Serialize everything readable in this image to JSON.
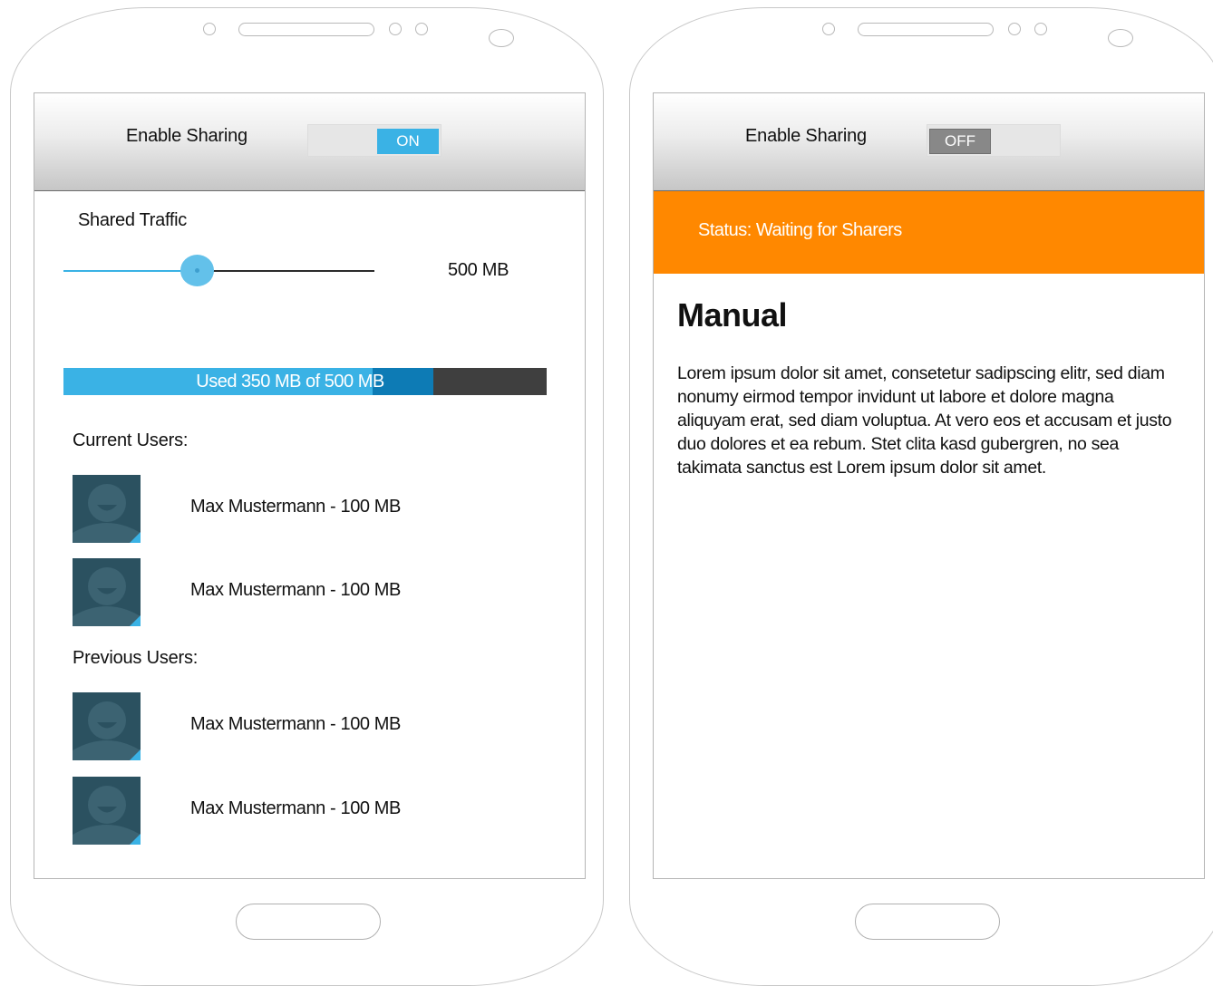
{
  "screen_left": {
    "header": {
      "label": "Enable Sharing",
      "toggle_state": "ON",
      "toggle_color": "#3ab2e5"
    },
    "shared_traffic": {
      "label": "Shared Traffic",
      "slider_fraction": 0.43,
      "value_text": "500 MB"
    },
    "usage": {
      "label": "Used 350 MB of 500 MB",
      "used_mb": 350,
      "total_mb": 500
    },
    "current_users": {
      "label": "Current Users:",
      "items": [
        {
          "name": "Max Mustermann - 100 MB"
        },
        {
          "name": "Max Mustermann - 100 MB"
        }
      ]
    },
    "previous_users": {
      "label": "Previous Users:",
      "items": [
        {
          "name": "Max Mustermann - 100 MB"
        },
        {
          "name": "Max Mustermann - 100 MB"
        }
      ]
    },
    "avatar_icon": "user-avatar-icon"
  },
  "screen_right": {
    "header": {
      "label": "Enable Sharing",
      "toggle_state": "OFF",
      "toggle_color": "#888888"
    },
    "status": {
      "text": "Status: Waiting for Sharers",
      "color": "#ff8800"
    },
    "manual": {
      "title": "Manual",
      "body": "Lorem ipsum dolor sit amet, consetetur sadipscing elitr, sed diam nonumy eirmod tempor invidunt ut labore et dolore magna aliquyam erat, sed diam voluptua. At vero eos et accusam et justo duo dolores et ea rebum. Stet clita kasd gubergren, no sea takimata sanctus est Lorem ipsum dolor sit amet."
    }
  }
}
